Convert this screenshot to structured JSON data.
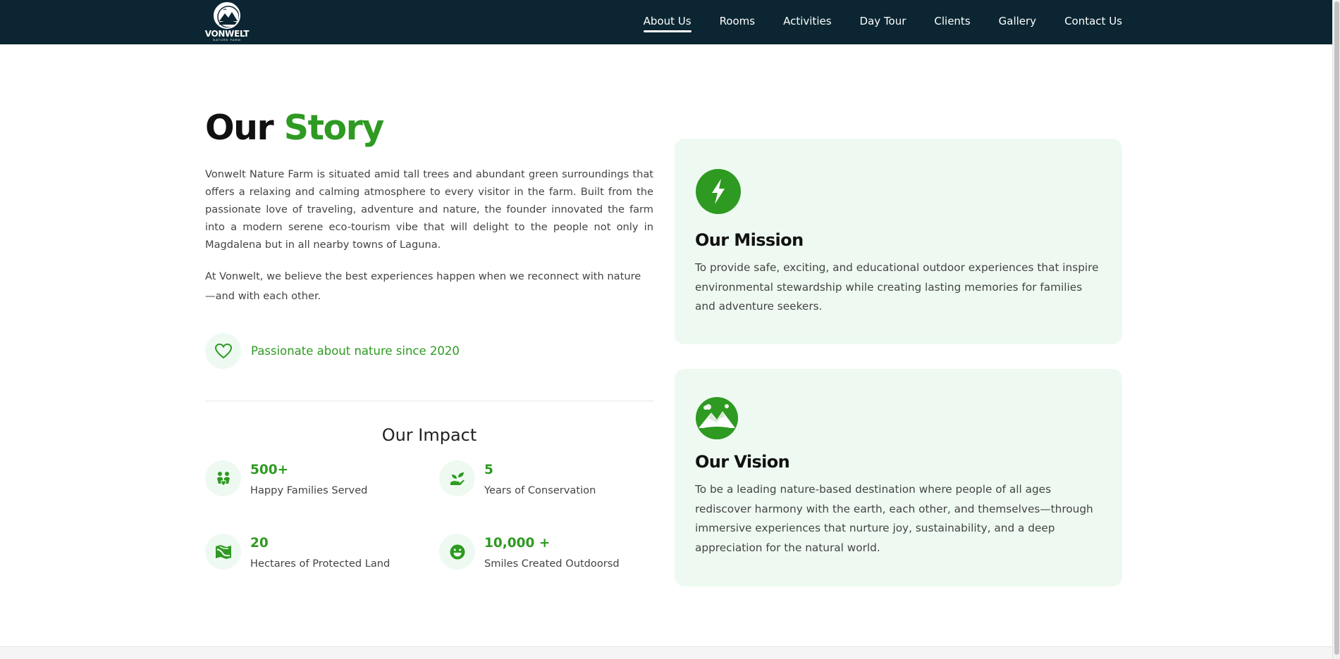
{
  "nav": {
    "logo_text": "VONWELT",
    "logo_sub": "NATURE FARM",
    "links": [
      {
        "label": "About Us",
        "active": true
      },
      {
        "label": "Rooms"
      },
      {
        "label": "Activities"
      },
      {
        "label": "Day Tour"
      },
      {
        "label": "Clients"
      },
      {
        "label": "Gallery"
      },
      {
        "label": "Contact Us"
      }
    ],
    "background": "#0b2632"
  },
  "story": {
    "title_dark": "Our",
    "title_green": "Story",
    "paragraph1": "Vonwelt Nature Farm is situated amid tall trees and abundant green surroundings that offers a relaxing and calming atmosphere to every visitor in the farm. Built from the passionate love of traveling, adventure and nature, the founder innovated the farm into a modern serene eco-tourism vibe that will delight to the people not only in Magdalena but in all nearby towns of Laguna.",
    "paragraph2": "At Vonwelt, we believe the best experiences happen when we reconnect with nature —and with each other.",
    "passion_text": "Passionate about nature since 2020",
    "passion_icon": "heart-icon"
  },
  "impact": {
    "title": "Our Impact",
    "stats": [
      {
        "value": "500+",
        "label": "Happy Families Served",
        "icon": "family-icon"
      },
      {
        "value": "5",
        "label": "Years of Conservation",
        "icon": "seedling-icon"
      },
      {
        "value": "20",
        "label": "Hectares of Protected Land",
        "icon": "map-icon"
      },
      {
        "value": "10,000 +",
        "label": "Smiles Created Outdoorsd",
        "icon": "smile-icon"
      }
    ]
  },
  "mission": {
    "title": "Our Mission",
    "text": "To provide safe, exciting, and educational outdoor experiences that inspire environmental stewardship while creating lasting memories for families and adventure seekers.",
    "icon": "bolt-icon"
  },
  "vision": {
    "title": "Our Vision",
    "text": "To be a leading nature-based destination where people of all ages rediscover harmony with the earth, each other, and themselves—through immersive experiences that nurture joy, sustainability, and a deep appreciation for the natural world.",
    "icon": "mountain-icon"
  },
  "colors": {
    "accent": "#2e9a22",
    "card_bg": "#eefaf1",
    "heading": "#111111"
  }
}
